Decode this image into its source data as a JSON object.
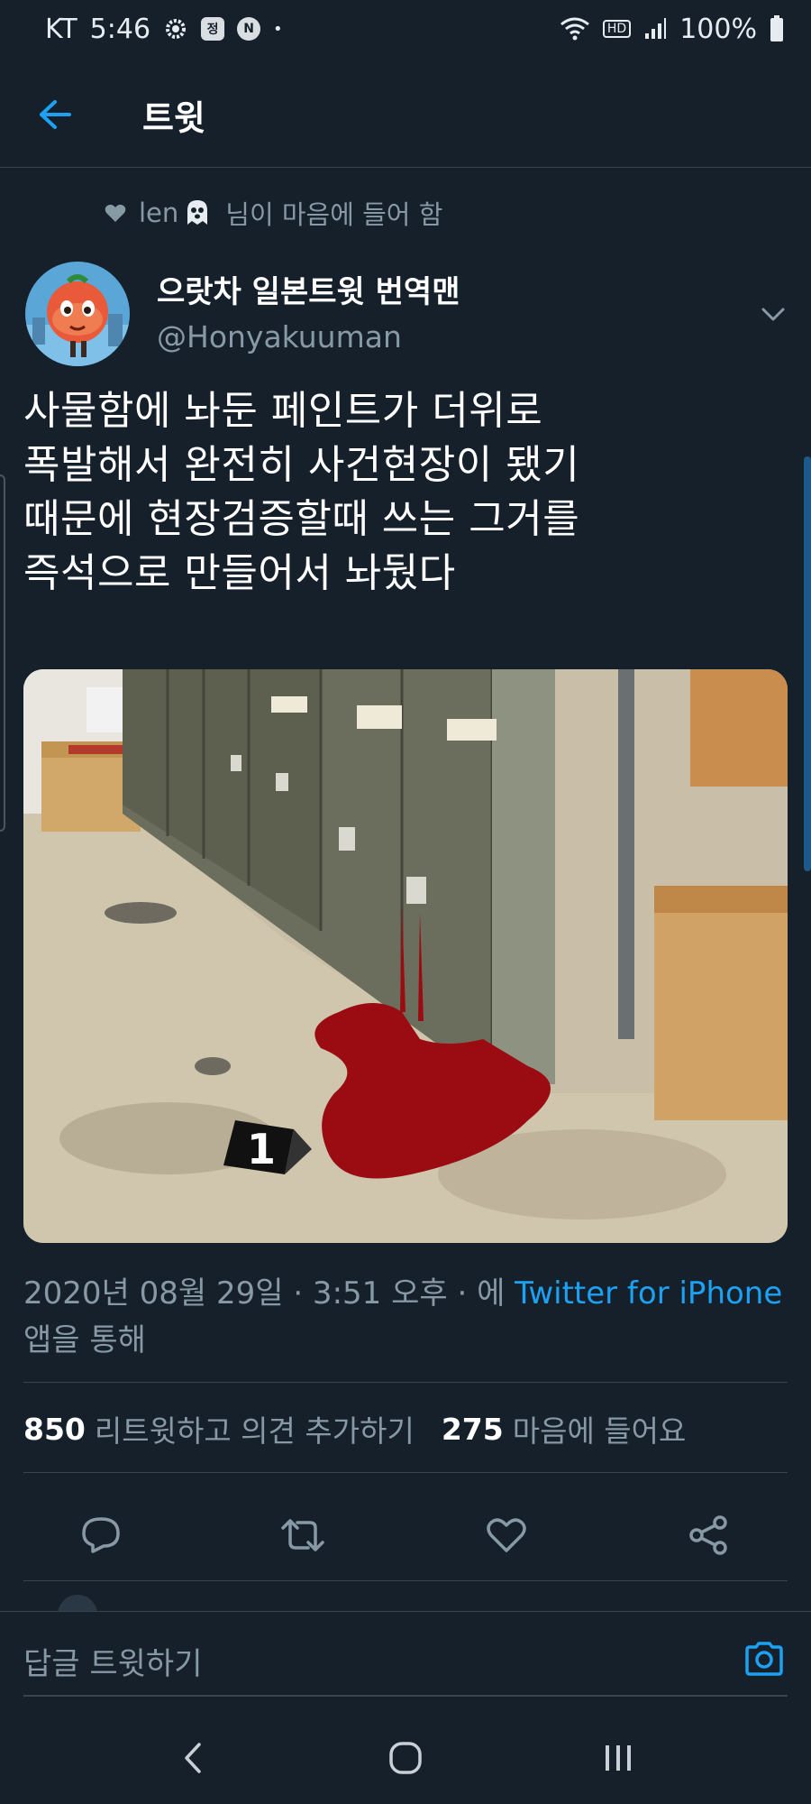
{
  "status_bar": {
    "carrier": "KT",
    "time": "5:46",
    "battery": "100%",
    "icons": [
      "settings-gear-icon",
      "news-badge-icon",
      "naver-n-icon",
      "dot-icon",
      "wifi-icon",
      "hd-voice-icon",
      "signal-icon",
      "battery-icon"
    ],
    "hd_label": "HD",
    "box_label_1": "정",
    "box_label_2": "N",
    "dot": "•"
  },
  "header": {
    "title": "트윗",
    "back_icon": "arrow-left-icon"
  },
  "social_context": {
    "user": "len",
    "text": "님이 마음에 들어 함",
    "icon": "heart-icon",
    "emoji_icon": "ghost-icon"
  },
  "author": {
    "name": "으랏차 일본트윗 번역맨",
    "handle": "@Honyakuuman",
    "more_icon": "chevron-down-icon"
  },
  "tweet": {
    "lines": [
      "사물함에 놔둔 페인트가 더위로",
      "폭발해서 완전히 사건현장이 됐기",
      "때문에 현장검증할때 쓰는 그거를",
      "즉석으로 만들어서 놔뒀다"
    ],
    "media_marker": "1",
    "meta_date": "2020년 08월 29일 · 3:51 오후 · 에 ",
    "meta_client": "Twitter for iPhone",
    "meta_suffix": " 앱을 통해"
  },
  "stats": {
    "retweets_count": "850",
    "retweets_label": "리트윗하고 의견 추가하기",
    "likes_count": "275",
    "likes_label": "마음에 들어요"
  },
  "actions": {
    "icons": [
      "reply-icon",
      "retweet-icon",
      "like-icon",
      "share-icon"
    ]
  },
  "reply_bar": {
    "placeholder": "답글 트윗하기",
    "camera_icon": "camera-icon"
  },
  "nav": {
    "icons": [
      "nav-back-icon",
      "nav-home-icon",
      "nav-recents-icon"
    ]
  },
  "colors": {
    "background": "#15202b",
    "divider": "#38444d",
    "muted_text": "#8899a6",
    "accent": "#1da1f2",
    "paint_red": "#9b0b12"
  }
}
